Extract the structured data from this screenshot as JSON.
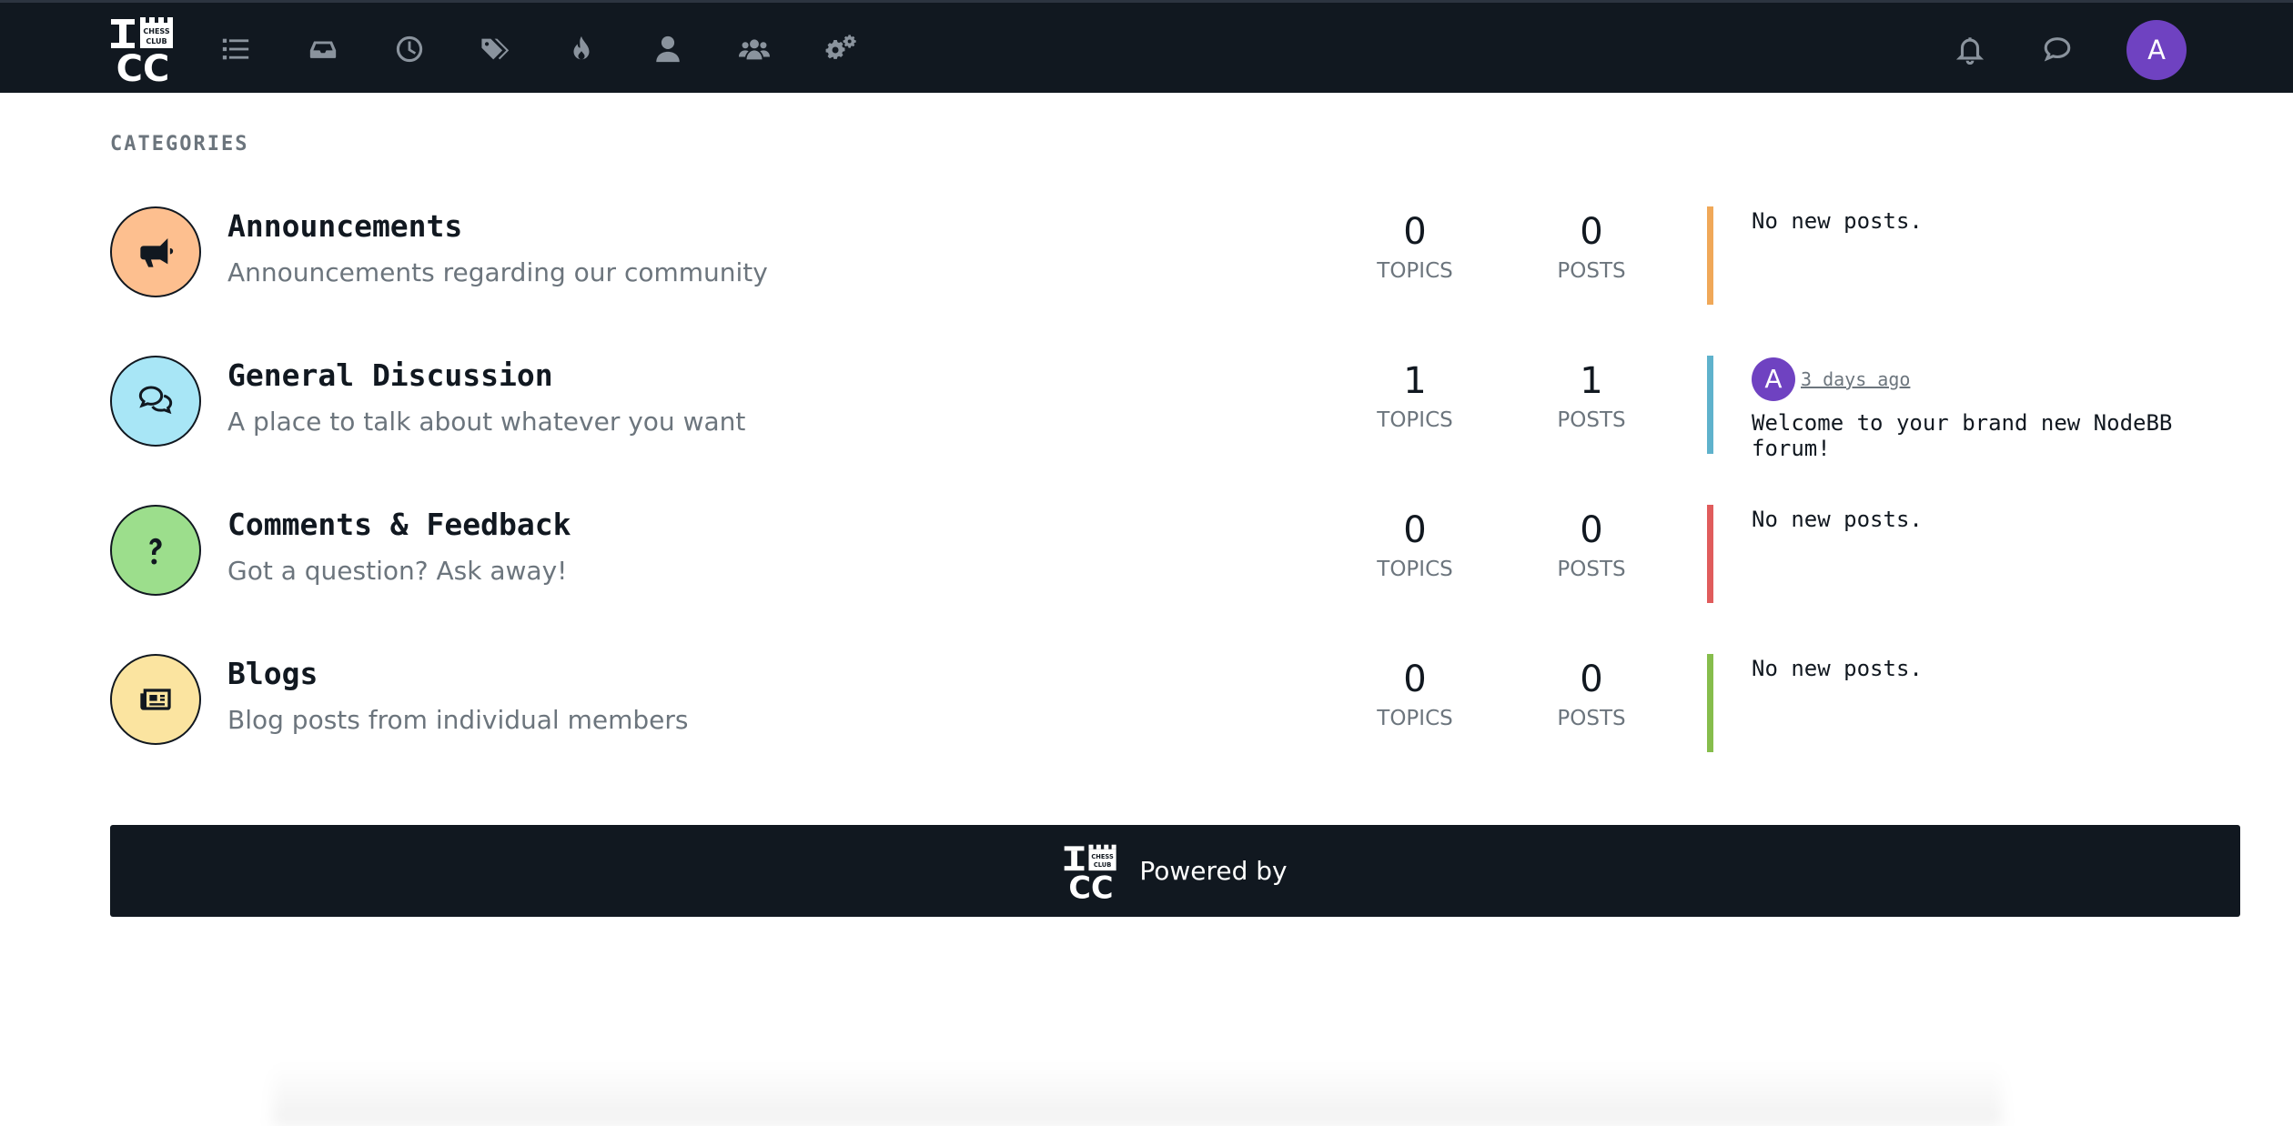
{
  "nav": {
    "logo_name": "ichess-club-logo",
    "items": [
      {
        "name": "categories-icon"
      },
      {
        "name": "unread-icon"
      },
      {
        "name": "recent-icon"
      },
      {
        "name": "tags-icon"
      },
      {
        "name": "popular-icon"
      },
      {
        "name": "users-icon"
      },
      {
        "name": "groups-icon"
      },
      {
        "name": "admin-icon"
      }
    ],
    "notifications_icon": "bell-icon",
    "chats_icon": "chat-icon",
    "user_initial": "A",
    "user_avatar_color": "#6f42c1"
  },
  "section_title": "CATEGORIES",
  "categories": [
    {
      "title": "Announcements",
      "description": "Announcements regarding our community",
      "icon": "bullhorn-icon",
      "bg_color": "#fdbf8f",
      "bar_color": "#f0a858",
      "topics": "0",
      "topics_label": "TOPICS",
      "posts": "0",
      "posts_label": "POSTS",
      "last_post": "No new posts."
    },
    {
      "title": "General Discussion",
      "description": "A place to talk about whatever you want",
      "icon": "comments-icon",
      "bg_color": "#a8e6f6",
      "bar_color": "#5fb2cc",
      "topics": "1",
      "topics_label": "TOPICS",
      "posts": "1",
      "posts_label": "POSTS",
      "last_post_user_initial": "A",
      "last_post_time": "3 days ago",
      "last_post": "Welcome to your brand new NodeBB forum!"
    },
    {
      "title": "Comments & Feedback",
      "description": "Got a question? Ask away!",
      "icon": "question-icon",
      "bg_color": "#9cde8c",
      "bar_color": "#e05c5c",
      "topics": "0",
      "topics_label": "TOPICS",
      "posts": "0",
      "posts_label": "POSTS",
      "last_post": "No new posts."
    },
    {
      "title": "Blogs",
      "description": "Blog posts from individual members",
      "icon": "newspaper-icon",
      "bg_color": "#fbe4a0",
      "bar_color": "#86bd4c",
      "topics": "0",
      "topics_label": "TOPICS",
      "posts": "0",
      "posts_label": "POSTS",
      "last_post": "No new posts."
    }
  ],
  "footer": {
    "text": "Powered by"
  }
}
